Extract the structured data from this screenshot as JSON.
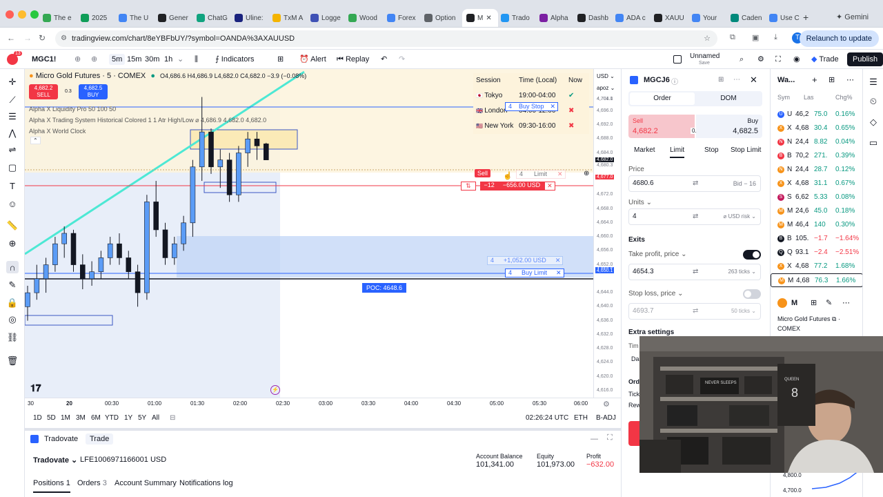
{
  "browser": {
    "tabs": [
      "The e",
      "2025",
      "The U",
      "Gener",
      "ChatG",
      "Uline:",
      "TxM A",
      "Logge",
      "Wood",
      "Forex",
      "Option",
      "M",
      "Trado",
      "Alpha",
      "Dashb",
      "ADA c",
      "XAUU",
      "Your",
      "Caden",
      "Use C"
    ],
    "profile_label": "Gemini",
    "url": "tradingview.com/chart/8eYBFbUY/?symbol=OANDA%3AXAUUSD",
    "relaunch_label": "Relaunch to update",
    "avatar_letter": "T"
  },
  "toolbar": {
    "notif_count": "13",
    "symbol": "MGC1!",
    "intervals": [
      "5m",
      "15m",
      "30m",
      "1h"
    ],
    "indicators_label": "Indicators",
    "alert_label": "Alert",
    "replay_label": "Replay",
    "layout_name": "Unnamed",
    "layout_status": "Save",
    "trade_label": "Trade",
    "publish_label": "Publish"
  },
  "legend": {
    "title": "Micro Gold Futures · 5 · COMEX",
    "ohlc": "O4,686.6  H4,686.9  L4,682.0  C4,682.0  −3.9 (−0.08%)",
    "sell_price": "4,682.2",
    "sell_label": "SELL",
    "spread": "0.3",
    "buy_price": "4,682.5",
    "buy_label": "BUY",
    "indicators": [
      "Alpha X Liquidity Pro 50 100 50",
      "Alpha X Trading System Historical Colored 1 1 Atr High/Low  ⌀ 4,686.9  4,682.0  4,682.0",
      "Alpha X World Clock"
    ]
  },
  "sessions": {
    "headers": [
      "Session",
      "Time (Local)",
      "Now"
    ],
    "rows": [
      {
        "name": "Tokyo",
        "time": "19:00-04:00",
        "now": "✔"
      },
      {
        "name": "London",
        "time": "04:00-12:00",
        "now": "✖"
      },
      {
        "name": "New York",
        "time": "09:30-16:00",
        "now": "✖"
      }
    ]
  },
  "chart_labels": {
    "buy_stop_qty": "4",
    "buy_stop_label": "Buy Stop",
    "sell_tag": "Sell",
    "limit_qty": "4",
    "limit_label": "Limit",
    "position_qty": "−12",
    "position_pnl": "−656.00 USD",
    "tp_qty": "4",
    "tp_pnl": "+1,052.00 USD",
    "buy_limit_qty": "4",
    "buy_limit_label": "Buy Limit",
    "poc_label": "POC: 4648.6"
  },
  "chart_data": {
    "type": "candlestick",
    "title": "Micro Gold Futures · 5 · COMEX",
    "y_ticks": [
      "4,704.0",
      "4,701.1",
      "4,696.0",
      "4,692.0",
      "4,688.0",
      "4,684.0",
      "4,682.0",
      "4,680.3",
      "4,677.0",
      "4,672.0",
      "4,668.0",
      "4,664.0",
      "4,660.0",
      "4,656.0",
      "4,652.0",
      "4,650.6",
      "4,650.1",
      "4,644.0",
      "4,640.0",
      "4,636.0",
      "4,632.0",
      "4,628.0",
      "4,624.0",
      "4,620.0",
      "4,616.0"
    ],
    "x_ticks": [
      "30",
      "20",
      "00:30",
      "01:00",
      "01:30",
      "02:00",
      "02:30",
      "03:00",
      "03:30",
      "04:00",
      "04:30",
      "05:00",
      "05:30",
      "06:00"
    ],
    "ylim": [
      4614,
      4708
    ],
    "candles": [
      {
        "o": 4640,
        "h": 4646,
        "l": 4636,
        "c": 4644
      },
      {
        "o": 4644,
        "h": 4652,
        "l": 4642,
        "c": 4648
      },
      {
        "o": 4648,
        "h": 4654,
        "l": 4644,
        "c": 4652
      },
      {
        "o": 4652,
        "h": 4660,
        "l": 4650,
        "c": 4658
      },
      {
        "o": 4658,
        "h": 4663,
        "l": 4654,
        "c": 4661
      },
      {
        "o": 4661,
        "h": 4662,
        "l": 4650,
        "c": 4652
      },
      {
        "o": 4652,
        "h": 4655,
        "l": 4645,
        "c": 4648
      },
      {
        "o": 4648,
        "h": 4653,
        "l": 4646,
        "c": 4650
      },
      {
        "o": 4650,
        "h": 4656,
        "l": 4648,
        "c": 4654
      },
      {
        "o": 4654,
        "h": 4660,
        "l": 4652,
        "c": 4658
      },
      {
        "o": 4658,
        "h": 4661,
        "l": 4652,
        "c": 4654
      },
      {
        "o": 4654,
        "h": 4656,
        "l": 4648,
        "c": 4650
      },
      {
        "o": 4650,
        "h": 4652,
        "l": 4640,
        "c": 4644
      },
      {
        "o": 4644,
        "h": 4672,
        "l": 4642,
        "c": 4670
      },
      {
        "o": 4670,
        "h": 4676,
        "l": 4660,
        "c": 4662
      },
      {
        "o": 4662,
        "h": 4664,
        "l": 4652,
        "c": 4654
      },
      {
        "o": 4654,
        "h": 4660,
        "l": 4652,
        "c": 4658
      },
      {
        "o": 4658,
        "h": 4666,
        "l": 4656,
        "c": 4664
      },
      {
        "o": 4664,
        "h": 4682,
        "l": 4660,
        "c": 4680
      },
      {
        "o": 4680,
        "h": 4700,
        "l": 4676,
        "c": 4690
      },
      {
        "o": 4690,
        "h": 4691,
        "l": 4678,
        "c": 4680
      },
      {
        "o": 4680,
        "h": 4685,
        "l": 4674,
        "c": 4682
      },
      {
        "o": 4682,
        "h": 4684,
        "l": 4670,
        "c": 4672
      },
      {
        "o": 4672,
        "h": 4686,
        "l": 4670,
        "c": 4684
      },
      {
        "o": 4684,
        "h": 4690,
        "l": 4680,
        "c": 4688
      },
      {
        "o": 4688,
        "h": 4690,
        "l": 4682,
        "c": 4686
      },
      {
        "o": 4686.6,
        "h": 4686.9,
        "l": 4682,
        "c": 4682
      }
    ]
  },
  "time_bar": {
    "ranges": [
      "1D",
      "5D",
      "1M",
      "3M",
      "6M",
      "YTD",
      "1Y",
      "5Y",
      "All"
    ],
    "clock": "02:26:24 UTC",
    "session": "ETH",
    "adj": "B-ADJ"
  },
  "account": {
    "broker_tab": "Tradovate",
    "trade_tab": "Trade",
    "broker": "Tradovate",
    "account_id": "LFE1006971166001 USD",
    "balance_label": "Account Balance",
    "balance": "101,341.00",
    "equity_label": "Equity",
    "equity": "101,973.00",
    "profit_label": "Profit",
    "profit": "−632.00",
    "tabs": [
      "Positions",
      "Orders",
      "Account Summary",
      "Notifications log"
    ],
    "positions_count": "1",
    "orders_count": "3"
  },
  "order_panel": {
    "symbol": "MGCJ6",
    "tabs": [
      "Order",
      "DOM"
    ],
    "sell_label": "Sell",
    "sell_price": "4,682.2",
    "spread": "0.3",
    "buy_label": "Buy",
    "buy_price": "4,682.5",
    "types": [
      "Market",
      "Limit",
      "Stop",
      "Stop Limit"
    ],
    "price_label": "Price",
    "price_value": "4680.6",
    "price_hint": "Bid − 16",
    "units_label": "Units",
    "units_value": "4",
    "units_hint": "⌀ USD risk",
    "exits_label": "Exits",
    "tp_label": "Take profit, price",
    "tp_value": "4654.3",
    "tp_ticks": "263 ticks",
    "sl_label": "Stop loss, price",
    "sl_value": "4693.7",
    "sl_ticks": "50 ticks",
    "extra_label": "Extra settings",
    "cut_labels": [
      "Tim",
      "Da",
      "Ord",
      "Tick",
      "Rew"
    ]
  },
  "watchlist": {
    "title": "Wa...",
    "headers": [
      "Sym",
      "Las",
      "Chg%"
    ],
    "rows": [
      {
        "icon": "U",
        "color": "#2962ff",
        "sym": "U",
        "last": "46,2",
        "chg": "75.0",
        "pct": "0.16%",
        "up": true
      },
      {
        "icon": "X",
        "color": "#f7931a",
        "sym": "X",
        "last": "4,68",
        "chg": "30.4",
        "pct": "0.65%",
        "up": true
      },
      {
        "icon": "N",
        "color": "#f23645",
        "sym": "N",
        "last": "24,4",
        "chg": "8.82",
        "pct": "0.04%",
        "up": true
      },
      {
        "icon": "B",
        "color": "#f23645",
        "sym": "B",
        "last": "70,2",
        "chg": "271.",
        "pct": "0.39%",
        "up": true
      },
      {
        "icon": "N",
        "color": "#f7931a",
        "sym": "N",
        "last": "24,4",
        "chg": "28.7",
        "pct": "0.12%",
        "up": true
      },
      {
        "icon": "X",
        "color": "#f7931a",
        "sym": "X",
        "last": "4,68",
        "chg": "31.1",
        "pct": "0.67%",
        "up": true
      },
      {
        "icon": "S",
        "color": "#c2185b",
        "sym": "S",
        "last": "6,62",
        "chg": "5.33",
        "pct": "0.08%",
        "up": true
      },
      {
        "icon": "M",
        "color": "#f7931a",
        "sym": "M",
        "last": "24,6",
        "chg": "45.0",
        "pct": "0.18%",
        "up": true
      },
      {
        "icon": "M",
        "color": "#f7931a",
        "sym": "M",
        "last": "46,4",
        "chg": "140",
        "pct": "0.30%",
        "up": true
      },
      {
        "icon": "B",
        "color": "#131722",
        "sym": "B",
        "last": "105.",
        "chg": "−1.7",
        "pct": "−1.64%",
        "up": false
      },
      {
        "icon": "Q",
        "color": "#131722",
        "sym": "Q",
        "last": "93.1",
        "chg": "−2.4",
        "pct": "−2.51%",
        "up": false
      },
      {
        "icon": "X",
        "color": "#f7931a",
        "sym": "X",
        "last": "4,68",
        "chg": "77.2",
        "pct": "1.68%",
        "up": true
      },
      {
        "icon": "M",
        "color": "#f7931a",
        "sym": "M",
        "last": "4,68",
        "chg": "76.3",
        "pct": "1.66%",
        "up": true
      }
    ],
    "detail_symbol": "M",
    "detail_name": "Micro Gold Futures ⧉ ·",
    "detail_exchange": "COMEX",
    "mini_ticks": [
      "4,800.0",
      "4,700.0"
    ]
  },
  "webcam": {
    "hat_text": "NEVER SLEEPS",
    "jersey_text": "QUEEN",
    "jersey_number": "8"
  },
  "colors": {
    "accent": "#2962ff",
    "up": "#089981",
    "down": "#f23645",
    "candle_up": "#5b9cf6",
    "candle_down": "#131722"
  }
}
